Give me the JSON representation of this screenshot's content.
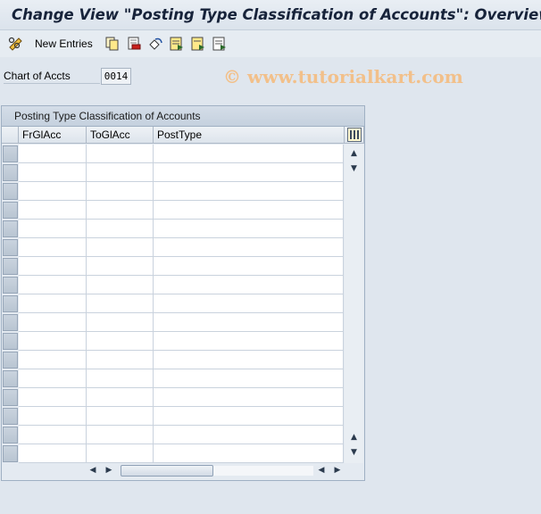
{
  "window": {
    "title": "Change View \"Posting Type Classification of Accounts\": Overview"
  },
  "toolbar": {
    "new_entries_label": "New Entries",
    "icons": [
      "glasses-pen-icon",
      "copy-icon",
      "delete-icon",
      "undo-icon",
      "select-all-icon",
      "select-block-icon",
      "deselect-icon"
    ]
  },
  "watermark": "© www.tutorialkart.com",
  "form": {
    "chart_of_accts_label": "Chart of Accts",
    "chart_of_accts_value": "0014"
  },
  "table": {
    "title": "Posting Type Classification of Accounts",
    "columns": [
      "FrGlAcc",
      "ToGlAcc",
      "PostType"
    ],
    "rows": [
      [
        "",
        "",
        ""
      ],
      [
        "",
        "",
        ""
      ],
      [
        "",
        "",
        ""
      ],
      [
        "",
        "",
        ""
      ],
      [
        "",
        "",
        ""
      ],
      [
        "",
        "",
        ""
      ],
      [
        "",
        "",
        ""
      ],
      [
        "",
        "",
        ""
      ],
      [
        "",
        "",
        ""
      ],
      [
        "",
        "",
        ""
      ],
      [
        "",
        "",
        ""
      ],
      [
        "",
        "",
        ""
      ],
      [
        "",
        "",
        ""
      ],
      [
        "",
        "",
        ""
      ],
      [
        "",
        "",
        ""
      ],
      [
        "",
        "",
        ""
      ],
      [
        "",
        "",
        ""
      ]
    ]
  },
  "colors": {
    "background": "#dfe6ee",
    "title_text": "#17233a",
    "watermark": "#f2c08a"
  }
}
